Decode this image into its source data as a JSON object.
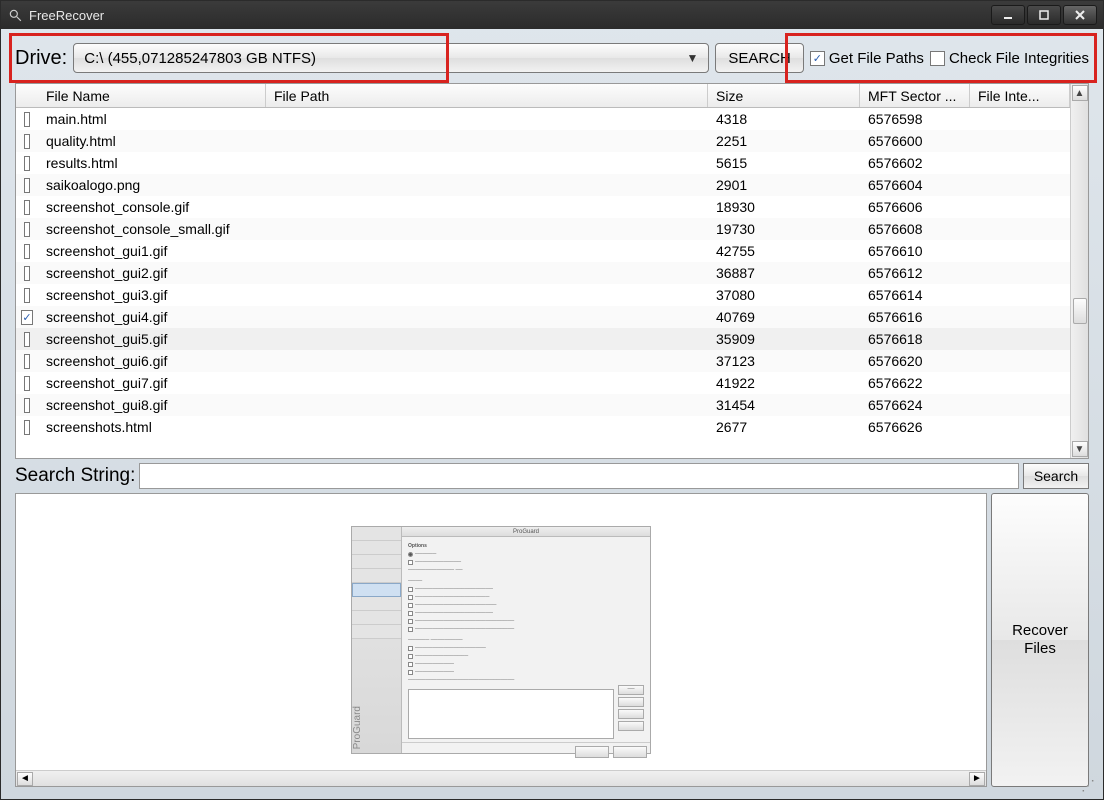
{
  "title": "FreeRecover",
  "toolbar": {
    "drive_label": "Drive:",
    "drive_value": "C:\\ (455,071285247803 GB NTFS)",
    "search_btn": "SEARCH",
    "get_file_paths": {
      "label": "Get File Paths",
      "checked": true
    },
    "check_file_integrities": {
      "label": "Check File Integrities",
      "checked": false
    }
  },
  "columns": {
    "name": "File Name",
    "path": "File Path",
    "size": "Size",
    "mft": "MFT Sector ...",
    "integrity": "File Inte..."
  },
  "rows": [
    {
      "checked": false,
      "name": "main.html",
      "path": "",
      "size": "4318",
      "mft": "6576598",
      "integrity": ""
    },
    {
      "checked": false,
      "name": "quality.html",
      "path": "",
      "size": "2251",
      "mft": "6576600",
      "integrity": ""
    },
    {
      "checked": false,
      "name": "results.html",
      "path": "",
      "size": "5615",
      "mft": "6576602",
      "integrity": ""
    },
    {
      "checked": false,
      "name": "saikoalogo.png",
      "path": "",
      "size": "2901",
      "mft": "6576604",
      "integrity": ""
    },
    {
      "checked": false,
      "name": "screenshot_console.gif",
      "path": "",
      "size": "18930",
      "mft": "6576606",
      "integrity": ""
    },
    {
      "checked": false,
      "name": "screenshot_console_small.gif",
      "path": "",
      "size": "19730",
      "mft": "6576608",
      "integrity": ""
    },
    {
      "checked": false,
      "name": "screenshot_gui1.gif",
      "path": "",
      "size": "42755",
      "mft": "6576610",
      "integrity": ""
    },
    {
      "checked": false,
      "name": "screenshot_gui2.gif",
      "path": "",
      "size": "36887",
      "mft": "6576612",
      "integrity": ""
    },
    {
      "checked": false,
      "name": "screenshot_gui3.gif",
      "path": "",
      "size": "37080",
      "mft": "6576614",
      "integrity": ""
    },
    {
      "checked": true,
      "name": "screenshot_gui4.gif",
      "path": "",
      "size": "40769",
      "mft": "6576616",
      "integrity": ""
    },
    {
      "checked": false,
      "name": "screenshot_gui5.gif",
      "path": "",
      "size": "35909",
      "mft": "6576618",
      "integrity": "",
      "hover": true
    },
    {
      "checked": false,
      "name": "screenshot_gui6.gif",
      "path": "",
      "size": "37123",
      "mft": "6576620",
      "integrity": ""
    },
    {
      "checked": false,
      "name": "screenshot_gui7.gif",
      "path": "",
      "size": "41922",
      "mft": "6576622",
      "integrity": ""
    },
    {
      "checked": false,
      "name": "screenshot_gui8.gif",
      "path": "",
      "size": "31454",
      "mft": "6576624",
      "integrity": ""
    },
    {
      "checked": false,
      "name": "screenshots.html",
      "path": "",
      "size": "2677",
      "mft": "6576626",
      "integrity": ""
    }
  ],
  "search": {
    "label": "Search String:",
    "btn": "Search",
    "value": ""
  },
  "recover_btn": "Recover\nFiles",
  "preview": {
    "title": "ProGuard",
    "vlabel": "ProGuard"
  }
}
